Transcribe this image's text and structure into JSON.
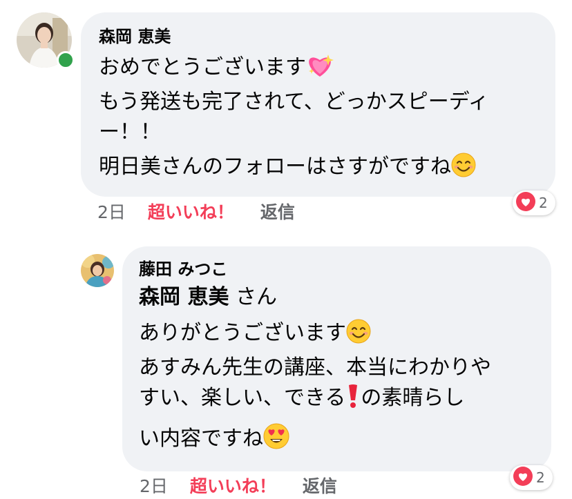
{
  "comment1": {
    "author": "森岡 恵美",
    "lines": [
      "おめでとうございます",
      "もう発送も完了されて、どっかスピーディ",
      "ー！！",
      "明日美さんのフォローはさすがですね"
    ],
    "time": "2日",
    "like_label": "超いいね！",
    "reply_label": "返信",
    "reaction_count": "2",
    "online": true
  },
  "comment2": {
    "author": "藤田 みつこ",
    "mention": "森岡 恵美",
    "mention_suffix": " さん",
    "lines": [
      "ありがとうございます",
      "あすみん先生の講座、本当にわかりや",
      "すい、楽しい、できる",
      "の素晴らし",
      "い内容ですね"
    ],
    "time": "2日",
    "like_label": "超いいね！",
    "reply_label": "返信",
    "reaction_count": "2"
  },
  "colors": {
    "bubble_bg": "#f0f2f5",
    "love_red": "#f33e58",
    "muted_text": "#65676b",
    "online_green": "#31a24c"
  },
  "icons": [
    "sparkling-heart-icon",
    "smiling-face-icon",
    "heart-eyes-icon",
    "red-exclamation-icon",
    "love-reaction-icon"
  ]
}
